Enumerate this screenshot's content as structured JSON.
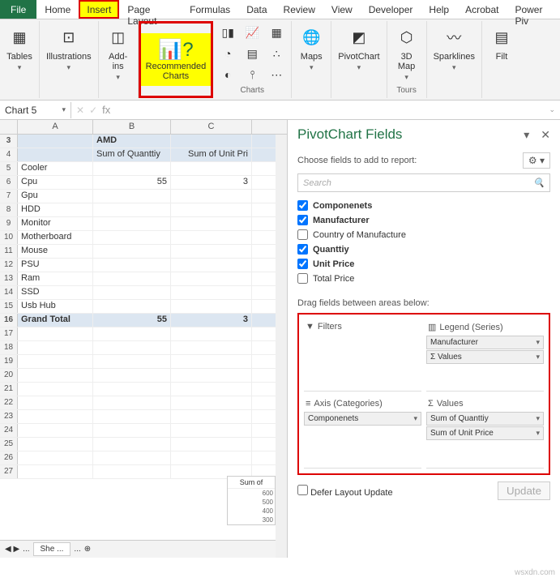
{
  "ribbon": {
    "tabs": [
      "File",
      "Home",
      "Insert",
      "Page Layout",
      "Formulas",
      "Data",
      "Review",
      "View",
      "Developer",
      "Help",
      "Acrobat",
      "Power Piv"
    ],
    "active_tab": "Insert",
    "groups": {
      "tables": "Tables",
      "illustrations": "Illustrations",
      "addins_label": "Add-\nins",
      "recommended": "Recommended\nCharts",
      "charts": "Charts",
      "maps": "Maps",
      "pivotchart": "PivotChart",
      "tours": "Tours",
      "map3d": "3D\nMap",
      "sparklines": "Sparklines",
      "filters": "Filt"
    }
  },
  "namebox": "Chart 5",
  "fx_symbols": {
    "cancel": "✕",
    "enter": "✓",
    "fx": "fx"
  },
  "columns": [
    "A",
    "B",
    "C"
  ],
  "rows": [
    {
      "n": 3,
      "a": "",
      "b": "AMD",
      "c": "",
      "cls": "pivot-header"
    },
    {
      "n": 4,
      "a": "",
      "b": "Sum of Quanttiy",
      "c": "Sum of Unit Pri",
      "cls": "pivot-sub"
    },
    {
      "n": 5,
      "a": "Cooler",
      "b": "",
      "c": ""
    },
    {
      "n": 6,
      "a": "Cpu",
      "b": "55",
      "c": "3"
    },
    {
      "n": 7,
      "a": "Gpu",
      "b": "",
      "c": ""
    },
    {
      "n": 8,
      "a": "HDD",
      "b": "",
      "c": ""
    },
    {
      "n": 9,
      "a": "Monitor",
      "b": "",
      "c": ""
    },
    {
      "n": 10,
      "a": "Motherboard",
      "b": "",
      "c": ""
    },
    {
      "n": 11,
      "a": "Mouse",
      "b": "",
      "c": ""
    },
    {
      "n": 12,
      "a": "PSU",
      "b": "",
      "c": ""
    },
    {
      "n": 13,
      "a": "Ram",
      "b": "",
      "c": ""
    },
    {
      "n": 14,
      "a": "SSD",
      "b": "",
      "c": ""
    },
    {
      "n": 15,
      "a": "Usb Hub",
      "b": "",
      "c": ""
    },
    {
      "n": 16,
      "a": "Grand Total",
      "b": "55",
      "c": "3",
      "cls": "pivot-header"
    },
    {
      "n": 17,
      "a": "",
      "b": "",
      "c": ""
    },
    {
      "n": 18,
      "a": "",
      "b": "",
      "c": ""
    },
    {
      "n": 19,
      "a": "",
      "b": "",
      "c": ""
    },
    {
      "n": 20,
      "a": "",
      "b": "",
      "c": ""
    },
    {
      "n": 21,
      "a": "",
      "b": "",
      "c": ""
    },
    {
      "n": 22,
      "a": "",
      "b": "",
      "c": ""
    },
    {
      "n": 23,
      "a": "",
      "b": "",
      "c": ""
    },
    {
      "n": 24,
      "a": "",
      "b": "",
      "c": ""
    },
    {
      "n": 25,
      "a": "",
      "b": "",
      "c": ""
    },
    {
      "n": 26,
      "a": "",
      "b": "",
      "c": ""
    },
    {
      "n": 27,
      "a": "",
      "b": "",
      "c": ""
    }
  ],
  "chart_preview": {
    "legend": "Sum of",
    "yticks": [
      "600",
      "500",
      "400",
      "300"
    ]
  },
  "sheet_tabs": {
    "nav": "◀ ▶",
    "active": "She ...",
    "more": "...",
    "add": "⊕"
  },
  "pane": {
    "title": "PivotChart Fields",
    "subtitle": "Choose fields to add to report:",
    "search_placeholder": "Search",
    "fields": [
      {
        "label": "Componenets",
        "checked": true
      },
      {
        "label": "Manufacturer",
        "checked": true
      },
      {
        "label": "Country of Manufacture",
        "checked": false
      },
      {
        "label": "Quanttiy",
        "checked": true
      },
      {
        "label": "Unit Price",
        "checked": true
      },
      {
        "label": "Total Price",
        "checked": false
      }
    ],
    "drag_label": "Drag fields between areas below:",
    "areas": {
      "filters": {
        "title": "Filters",
        "icon": "▼",
        "items": []
      },
      "legend": {
        "title": "Legend (Series)",
        "icon": "▥",
        "items": [
          "Manufacturer",
          "Σ  Values"
        ]
      },
      "axis": {
        "title": "Axis (Categories)",
        "icon": "≡",
        "items": [
          "Componenets"
        ]
      },
      "values": {
        "title": "Values",
        "icon": "Σ",
        "items": [
          "Sum of Quanttiy",
          "Sum of Unit Price"
        ]
      }
    },
    "defer": "Defer Layout Update",
    "update": "Update"
  },
  "watermark": "wsxdn.com"
}
